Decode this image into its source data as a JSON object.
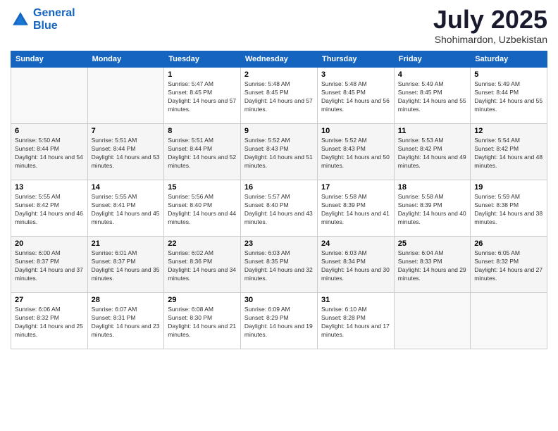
{
  "header": {
    "logo_line1": "General",
    "logo_line2": "Blue",
    "month": "July 2025",
    "location": "Shohimardon, Uzbekistan"
  },
  "weekdays": [
    "Sunday",
    "Monday",
    "Tuesday",
    "Wednesday",
    "Thursday",
    "Friday",
    "Saturday"
  ],
  "weeks": [
    [
      {
        "day": "",
        "info": ""
      },
      {
        "day": "",
        "info": ""
      },
      {
        "day": "1",
        "info": "Sunrise: 5:47 AM\nSunset: 8:45 PM\nDaylight: 14 hours and 57 minutes."
      },
      {
        "day": "2",
        "info": "Sunrise: 5:48 AM\nSunset: 8:45 PM\nDaylight: 14 hours and 57 minutes."
      },
      {
        "day": "3",
        "info": "Sunrise: 5:48 AM\nSunset: 8:45 PM\nDaylight: 14 hours and 56 minutes."
      },
      {
        "day": "4",
        "info": "Sunrise: 5:49 AM\nSunset: 8:45 PM\nDaylight: 14 hours and 55 minutes."
      },
      {
        "day": "5",
        "info": "Sunrise: 5:49 AM\nSunset: 8:44 PM\nDaylight: 14 hours and 55 minutes."
      }
    ],
    [
      {
        "day": "6",
        "info": "Sunrise: 5:50 AM\nSunset: 8:44 PM\nDaylight: 14 hours and 54 minutes."
      },
      {
        "day": "7",
        "info": "Sunrise: 5:51 AM\nSunset: 8:44 PM\nDaylight: 14 hours and 53 minutes."
      },
      {
        "day": "8",
        "info": "Sunrise: 5:51 AM\nSunset: 8:44 PM\nDaylight: 14 hours and 52 minutes."
      },
      {
        "day": "9",
        "info": "Sunrise: 5:52 AM\nSunset: 8:43 PM\nDaylight: 14 hours and 51 minutes."
      },
      {
        "day": "10",
        "info": "Sunrise: 5:52 AM\nSunset: 8:43 PM\nDaylight: 14 hours and 50 minutes."
      },
      {
        "day": "11",
        "info": "Sunrise: 5:53 AM\nSunset: 8:42 PM\nDaylight: 14 hours and 49 minutes."
      },
      {
        "day": "12",
        "info": "Sunrise: 5:54 AM\nSunset: 8:42 PM\nDaylight: 14 hours and 48 minutes."
      }
    ],
    [
      {
        "day": "13",
        "info": "Sunrise: 5:55 AM\nSunset: 8:42 PM\nDaylight: 14 hours and 46 minutes."
      },
      {
        "day": "14",
        "info": "Sunrise: 5:55 AM\nSunset: 8:41 PM\nDaylight: 14 hours and 45 minutes."
      },
      {
        "day": "15",
        "info": "Sunrise: 5:56 AM\nSunset: 8:40 PM\nDaylight: 14 hours and 44 minutes."
      },
      {
        "day": "16",
        "info": "Sunrise: 5:57 AM\nSunset: 8:40 PM\nDaylight: 14 hours and 43 minutes."
      },
      {
        "day": "17",
        "info": "Sunrise: 5:58 AM\nSunset: 8:39 PM\nDaylight: 14 hours and 41 minutes."
      },
      {
        "day": "18",
        "info": "Sunrise: 5:58 AM\nSunset: 8:39 PM\nDaylight: 14 hours and 40 minutes."
      },
      {
        "day": "19",
        "info": "Sunrise: 5:59 AM\nSunset: 8:38 PM\nDaylight: 14 hours and 38 minutes."
      }
    ],
    [
      {
        "day": "20",
        "info": "Sunrise: 6:00 AM\nSunset: 8:37 PM\nDaylight: 14 hours and 37 minutes."
      },
      {
        "day": "21",
        "info": "Sunrise: 6:01 AM\nSunset: 8:37 PM\nDaylight: 14 hours and 35 minutes."
      },
      {
        "day": "22",
        "info": "Sunrise: 6:02 AM\nSunset: 8:36 PM\nDaylight: 14 hours and 34 minutes."
      },
      {
        "day": "23",
        "info": "Sunrise: 6:03 AM\nSunset: 8:35 PM\nDaylight: 14 hours and 32 minutes."
      },
      {
        "day": "24",
        "info": "Sunrise: 6:03 AM\nSunset: 8:34 PM\nDaylight: 14 hours and 30 minutes."
      },
      {
        "day": "25",
        "info": "Sunrise: 6:04 AM\nSunset: 8:33 PM\nDaylight: 14 hours and 29 minutes."
      },
      {
        "day": "26",
        "info": "Sunrise: 6:05 AM\nSunset: 8:32 PM\nDaylight: 14 hours and 27 minutes."
      }
    ],
    [
      {
        "day": "27",
        "info": "Sunrise: 6:06 AM\nSunset: 8:32 PM\nDaylight: 14 hours and 25 minutes."
      },
      {
        "day": "28",
        "info": "Sunrise: 6:07 AM\nSunset: 8:31 PM\nDaylight: 14 hours and 23 minutes."
      },
      {
        "day": "29",
        "info": "Sunrise: 6:08 AM\nSunset: 8:30 PM\nDaylight: 14 hours and 21 minutes."
      },
      {
        "day": "30",
        "info": "Sunrise: 6:09 AM\nSunset: 8:29 PM\nDaylight: 14 hours and 19 minutes."
      },
      {
        "day": "31",
        "info": "Sunrise: 6:10 AM\nSunset: 8:28 PM\nDaylight: 14 hours and 17 minutes."
      },
      {
        "day": "",
        "info": ""
      },
      {
        "day": "",
        "info": ""
      }
    ]
  ]
}
